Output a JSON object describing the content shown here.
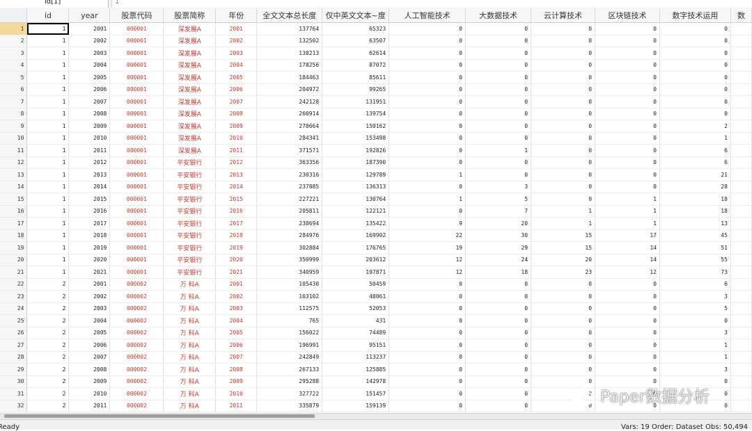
{
  "name_box": "id[1]",
  "value_box": "1",
  "columns": [
    "id",
    "year",
    "股票代码",
    "股票简称",
    "年份",
    "全文文本总长度",
    "仅中英文文本~度",
    "人工智能技术",
    "大数据技术",
    "云计算技术",
    "区块链技术",
    "数字技术运用",
    "数"
  ],
  "rows": [
    [
      "1",
      "1",
      "2001",
      "000001",
      "深发展A",
      "2001",
      "137764",
      "65323",
      "0",
      "0",
      "0",
      "0",
      "0"
    ],
    [
      "2",
      "1",
      "2002",
      "000001",
      "深发展A",
      "2002",
      "132502",
      "63507",
      "0",
      "0",
      "0",
      "0",
      "0"
    ],
    [
      "3",
      "1",
      "2003",
      "000001",
      "深发展A",
      "2003",
      "138213",
      "62614",
      "0",
      "0",
      "0",
      "0",
      "0"
    ],
    [
      "4",
      "1",
      "2004",
      "000001",
      "深发展A",
      "2004",
      "178256",
      "87072",
      "0",
      "0",
      "0",
      "0",
      "0"
    ],
    [
      "5",
      "1",
      "2005",
      "000001",
      "深发展A",
      "2005",
      "184463",
      "85611",
      "0",
      "0",
      "0",
      "0",
      "0"
    ],
    [
      "6",
      "1",
      "2006",
      "000001",
      "深发展A",
      "2006",
      "204972",
      "99265",
      "0",
      "0",
      "0",
      "0",
      "0"
    ],
    [
      "7",
      "1",
      "2007",
      "000001",
      "深发展A",
      "2007",
      "242128",
      "131951",
      "0",
      "0",
      "0",
      "0",
      "0"
    ],
    [
      "8",
      "1",
      "2008",
      "000001",
      "深发展A",
      "2008",
      "260914",
      "139754",
      "0",
      "0",
      "0",
      "0",
      "0"
    ],
    [
      "9",
      "1",
      "2009",
      "000001",
      "深发展A",
      "2009",
      "278664",
      "150162",
      "0",
      "0",
      "0",
      "0",
      "2"
    ],
    [
      "10",
      "1",
      "2010",
      "000001",
      "深发展A",
      "2010",
      "284341",
      "153498",
      "0",
      "0",
      "0",
      "0",
      "1"
    ],
    [
      "11",
      "1",
      "2011",
      "000001",
      "深发展A",
      "2011",
      "371571",
      "192826",
      "0",
      "1",
      "0",
      "0",
      "6"
    ],
    [
      "12",
      "1",
      "2012",
      "000001",
      "平安银行",
      "2012",
      "363356",
      "187390",
      "0",
      "0",
      "0",
      "0",
      "6"
    ],
    [
      "13",
      "1",
      "2013",
      "000001",
      "平安银行",
      "2013",
      "230316",
      "129789",
      "1",
      "0",
      "0",
      "0",
      "21"
    ],
    [
      "14",
      "1",
      "2014",
      "000001",
      "平安银行",
      "2014",
      "237885",
      "136313",
      "0",
      "3",
      "0",
      "0",
      "28"
    ],
    [
      "15",
      "1",
      "2015",
      "000001",
      "平安银行",
      "2015",
      "227221",
      "130764",
      "1",
      "5",
      "9",
      "1",
      "18"
    ],
    [
      "16",
      "1",
      "2016",
      "000001",
      "平安银行",
      "2016",
      "205811",
      "122121",
      "0",
      "7",
      "1",
      "1",
      "18"
    ],
    [
      "17",
      "1",
      "2017",
      "000001",
      "平安银行",
      "2017",
      "238694",
      "135422",
      "9",
      "20",
      "1",
      "1",
      "13"
    ],
    [
      "18",
      "1",
      "2018",
      "000001",
      "平安银行",
      "2018",
      "284976",
      "169902",
      "22",
      "30",
      "15",
      "17",
      "45"
    ],
    [
      "19",
      "1",
      "2019",
      "000001",
      "平安银行",
      "2019",
      "302884",
      "176765",
      "19",
      "29",
      "15",
      "14",
      "51"
    ],
    [
      "20",
      "1",
      "2020",
      "000001",
      "平安银行",
      "2020",
      "350999",
      "203612",
      "12",
      "24",
      "20",
      "14",
      "55"
    ],
    [
      "21",
      "1",
      "2021",
      "000001",
      "平安银行",
      "2021",
      "340959",
      "197871",
      "12",
      "18",
      "23",
      "12",
      "73"
    ],
    [
      "22",
      "2",
      "2001",
      "000002",
      "万 科A",
      "2001",
      "105430",
      "50459",
      "0",
      "0",
      "0",
      "0",
      "6"
    ],
    [
      "23",
      "2",
      "2002",
      "000002",
      "万 科A",
      "2002",
      "103102",
      "48061",
      "0",
      "0",
      "0",
      "0",
      "3"
    ],
    [
      "24",
      "2",
      "2003",
      "000002",
      "万 科A",
      "2003",
      "112575",
      "52053",
      "0",
      "0",
      "0",
      "0",
      "5"
    ],
    [
      "25",
      "2",
      "2004",
      "000002",
      "万 科A",
      "2004",
      "765",
      "431",
      "0",
      "0",
      "0",
      "0",
      "0"
    ],
    [
      "26",
      "2",
      "2005",
      "000002",
      "万 科A",
      "2005",
      "156022",
      "74489",
      "0",
      "0",
      "0",
      "0",
      "3"
    ],
    [
      "27",
      "2",
      "2006",
      "000002",
      "万 科A",
      "2006",
      "196991",
      "95151",
      "0",
      "0",
      "0",
      "0",
      "1"
    ],
    [
      "28",
      "2",
      "2007",
      "000002",
      "万 科A",
      "2007",
      "242849",
      "113237",
      "0",
      "0",
      "0",
      "0",
      "1"
    ],
    [
      "29",
      "2",
      "2008",
      "000002",
      "万 科A",
      "2008",
      "267133",
      "125885",
      "0",
      "0",
      "0",
      "0",
      "3"
    ],
    [
      "30",
      "2",
      "2009",
      "000002",
      "万 科A",
      "2009",
      "295288",
      "142978",
      "0",
      "0",
      "0",
      "0",
      "0"
    ],
    [
      "31",
      "2",
      "2010",
      "000002",
      "万 科A",
      "2010",
      "327722",
      "151457",
      "0",
      "0",
      "0",
      "0",
      "0"
    ],
    [
      "32",
      "2",
      "2011",
      "000002",
      "万 科A",
      "2011",
      "335879",
      "159139",
      "0",
      "0",
      "0",
      "0",
      "0"
    ]
  ],
  "status": {
    "ready": "Ready",
    "stats": "Vars: 19  Order: Dataset   Obs: 50,494"
  },
  "watermark": "Paper数据分析"
}
